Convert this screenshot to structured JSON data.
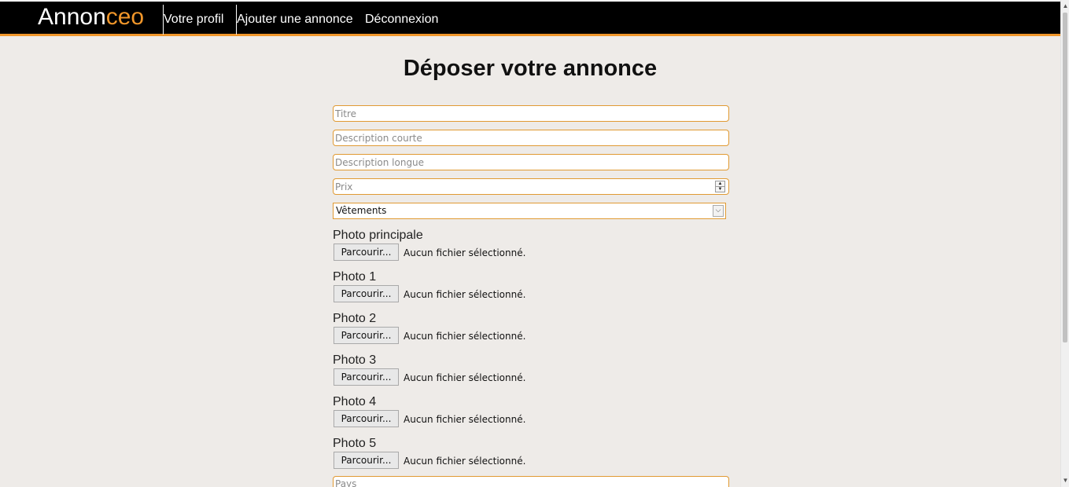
{
  "header": {
    "brand_main": "Annon",
    "brand_accent": "ceo",
    "nav": [
      "Votre profil",
      "Ajouter une annonce",
      "Déconnexion"
    ]
  },
  "page": {
    "title": "Déposer votre annonce"
  },
  "form": {
    "placeholders": {
      "titre": "Titre",
      "desc_courte": "Description courte",
      "desc_longue": "Description longue",
      "prix": "Prix",
      "pays": "Pays"
    },
    "category_selected": "Vêtements",
    "photos": [
      {
        "label": "Photo principale",
        "button": "Parcourir...",
        "status": "Aucun fichier sélectionné."
      },
      {
        "label": "Photo 1",
        "button": "Parcourir...",
        "status": "Aucun fichier sélectionné."
      },
      {
        "label": "Photo 2",
        "button": "Parcourir...",
        "status": "Aucun fichier sélectionné."
      },
      {
        "label": "Photo 3",
        "button": "Parcourir...",
        "status": "Aucun fichier sélectionné."
      },
      {
        "label": "Photo 4",
        "button": "Parcourir...",
        "status": "Aucun fichier sélectionné."
      },
      {
        "label": "Photo 5",
        "button": "Parcourir...",
        "status": "Aucun fichier sélectionné."
      }
    ]
  },
  "colors": {
    "accent": "#f0962a",
    "header_bg": "#000000",
    "page_bg": "#eeebe8"
  }
}
